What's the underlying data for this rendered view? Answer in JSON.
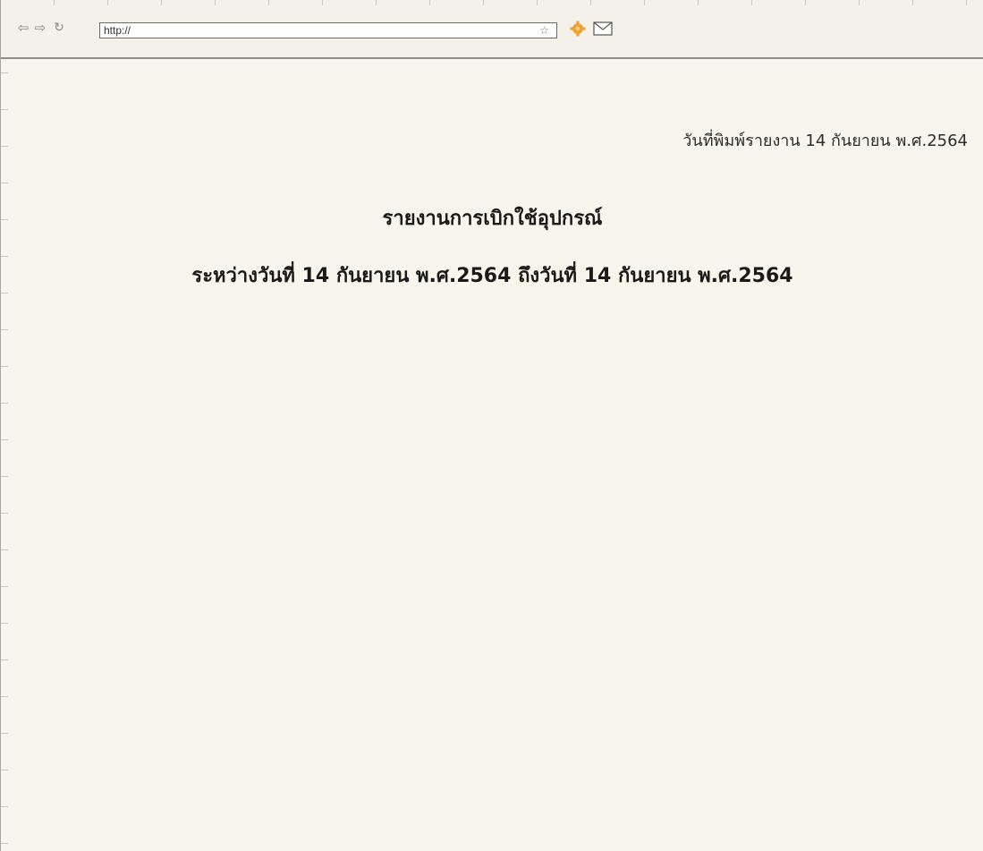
{
  "browser": {
    "address": "http://",
    "icons": [
      "back-arrow-icon",
      "forward-arrow-icon",
      "reload-icon",
      "star-icon",
      "extension-gear-icon",
      "mail-icon"
    ]
  },
  "report": {
    "print_date": "วันที่พิมพ์รายงาน 14 กันยายน พ.ศ.2564",
    "title": "รายงานการเบิกใช้อุปกรณ์",
    "date_range": "ระหว่างวันที่ 14 กันยายน พ.ศ.2564 ถึงวันที่ 14 กันยายน พ.ศ.2564"
  },
  "colors": {
    "page_background": "#f8f5ec",
    "toolbar_background": "#f3f1ea",
    "text": "#1a1a1a",
    "gear_accent": "#f0a030"
  }
}
